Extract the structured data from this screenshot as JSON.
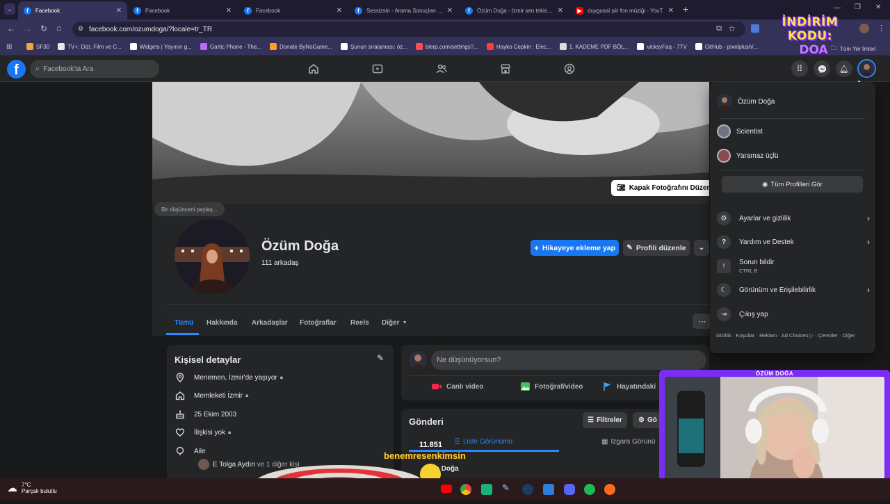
{
  "browser": {
    "tabs": [
      {
        "title": "Facebook",
        "icon": "facebook-icon",
        "active": true
      },
      {
        "title": "Facebook",
        "icon": "facebook-icon",
        "active": false
      },
      {
        "title": "Facebook",
        "icon": "facebook-icon",
        "active": false
      },
      {
        "title": "Sessizsin - Arama Sonuçları | Fa",
        "icon": "facebook-icon",
        "active": false
      },
      {
        "title": "Özüm Doğa - İzmir sen tekisn i...",
        "icon": "facebook-icon",
        "active": false
      },
      {
        "title": "duygusal şiir fon müziği - YouT",
        "icon": "youtube-icon",
        "active": false
      }
    ],
    "url": "facebook.com/ozumdoga/?locale=tr_TR",
    "bookmarks": [
      {
        "label": "SF30",
        "color": "#f2a33a"
      },
      {
        "label": "TV+: Dizi, Film ve C...",
        "color": "#e8e8e8"
      },
      {
        "label": "Widgets | Yayının g...",
        "color": "#ffffff"
      },
      {
        "label": "Gartic Phone - The...",
        "color": "#c266ff"
      },
      {
        "label": "Donate ByNoGame...",
        "color": "#ff9c2a"
      },
      {
        "label": "Şunun sıralaması: öz...",
        "color": "#ffffff"
      },
      {
        "label": "blerp.com/settings?...",
        "color": "#ff4d4d"
      },
      {
        "label": "Hayko Cepkin : Elec...",
        "color": "#ff3b3b"
      },
      {
        "label": "1. KADEME PDF BÖL...",
        "color": "#dddddd"
      },
      {
        "label": "vicksyFaq - 7TV",
        "color": "#ffffff"
      },
      {
        "label": "GitHub - pixelplush/...",
        "color": "#ffffff"
      }
    ],
    "other_bookmarks": "Tüm Yer İmleri"
  },
  "overlay": {
    "promo_line1": "İNDİRİM KODU:",
    "promo_line2": "DOA",
    "streamer_name": "ÖZÜM DOĞA",
    "chat_name": "benemresenkimsin"
  },
  "facebook": {
    "search_placeholder": "Facebook'ta Ara",
    "cover_edit_label": "Kapak Fotoğrafını Düzenle",
    "thought_bubble": "Bir düşünceni paylaş...",
    "profile_name": "Özüm Doğa",
    "friends_count": "111 arkadaş",
    "add_story_label": "Hikayeye ekleme yap",
    "edit_profile_label": "Profili düzenle",
    "tabs": [
      "Tümü",
      "Hakkında",
      "Arkadaşlar",
      "Fotoğraflar",
      "Reels",
      "Diğer"
    ],
    "details": {
      "title": "Kişisel detaylar",
      "items": [
        {
          "text": "Menemen, İzmir'de yaşıyor",
          "icon": "location-icon"
        },
        {
          "text": "Memleketi İzmir",
          "icon": "home-icon"
        },
        {
          "text": "25 Ekim 2003",
          "icon": "birthday-cake-icon"
        },
        {
          "text": "İlişkisi yok",
          "icon": "heart-icon"
        },
        {
          "text": "Aile",
          "icon": "family-icon"
        }
      ],
      "family_member": "E Tolga Aydın",
      "family_more": " ve 1 diğer kişi"
    },
    "composer": {
      "placeholder": "Ne düşünüyorsun?",
      "live_video": "Canlı video",
      "photo_video": "Fotoğraf/video",
      "life_event": "Hayatındaki"
    },
    "posts": {
      "title": "Gönderi",
      "filters": "Filtreler",
      "manage": "Gö",
      "count": "11.851",
      "list_view": "Liste Görünümü",
      "grid_view": "Izgara Görünü",
      "post_author": "m Doğa"
    },
    "menu": {
      "profiles": [
        {
          "name": "Özüm Doğa"
        },
        {
          "name": "Scientist"
        },
        {
          "name": "Yaramaz üçlü"
        }
      ],
      "see_all_profiles": "Tüm Profilleri Gör",
      "items": [
        {
          "label": "Ayarlar ve gizlilik",
          "icon": "gear-icon",
          "chevron": true
        },
        {
          "label": "Yardım ve Destek",
          "icon": "help-icon",
          "chevron": true
        },
        {
          "label": "Sorun bildir",
          "sub": "CTRL B",
          "icon": "report-icon",
          "chevron": false
        },
        {
          "label": "Görünüm ve Erişilebilirlik",
          "icon": "moon-icon",
          "chevron": true
        },
        {
          "label": "Çıkış yap",
          "icon": "logout-icon",
          "chevron": false
        }
      ],
      "footer": "Gizlilik · Koşullar · Reklam · Ad Choices ▷ · Çerezler · Diğer"
    }
  },
  "taskbar": {
    "temperature": "7°C",
    "weather": "Parçalı bulutlu"
  },
  "colors": {
    "fb_blue": "#1877f2",
    "fb_bg": "#18191a",
    "fb_card": "#242526",
    "stream_purple": "#7b2cf5"
  }
}
